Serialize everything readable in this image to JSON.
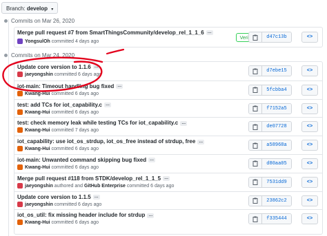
{
  "branch": {
    "label": "Branch:",
    "name": "develop"
  },
  "groups": [
    {
      "header": "Commits on Mar 26, 2020",
      "commits": [
        {
          "title": "Merge pull request #7 from SmartThingsCommunity/develop_rel_1_1_6",
          "author": "YongsulOh",
          "action": "committed",
          "coauthor": "",
          "time": "4 days ago",
          "sha": "d47c13b",
          "verified": "Verified",
          "avatar_color": "#6f42c1"
        }
      ]
    },
    {
      "header": "Commits on Mar 24, 2020",
      "commits": [
        {
          "title": "Update core version to 1.1.6",
          "author": "jaeyongshin",
          "action": "committed",
          "coauthor": "",
          "time": "6 days ago",
          "sha": "d7ebe15",
          "avatar_color": "#d73a49"
        },
        {
          "title": "iot-main: Timeout handling bug fixed",
          "author": "Kwang-Hui",
          "action": "committed",
          "coauthor": "",
          "time": "6 days ago",
          "sha": "5fcbba4",
          "avatar_color": "#e36209"
        },
        {
          "title": "test: add TCs for iot_capability.c",
          "author": "Kwang-Hui",
          "action": "committed",
          "coauthor": "",
          "time": "6 days ago",
          "sha": "f7152a5",
          "avatar_color": "#e36209"
        },
        {
          "title": "test: check memory leak while testing TCs for iot_capability.c",
          "author": "Kwang-Hui",
          "action": "committed",
          "coauthor": "",
          "time": "7 days ago",
          "sha": "de07728",
          "avatar_color": "#e36209"
        },
        {
          "title": "iot_capability: use iot_os_strdup, iot_os_free instead of strdup, free",
          "author": "Kwang-Hui",
          "action": "committed",
          "coauthor": "",
          "time": "6 days ago",
          "sha": "a58968a",
          "avatar_color": "#e36209"
        },
        {
          "title": "iot-main: Unwanted command skipping bug fixed",
          "author": "Kwang-Hui",
          "action": "committed",
          "coauthor": "",
          "time": "6 days ago",
          "sha": "d80aa05",
          "avatar_color": "#e36209"
        },
        {
          "title": "Merge pull request #118 from STDK/develop_rel_1_1_5",
          "author": "jaeyongshin",
          "action": "authored and",
          "coauthor": "GitHub Enterprise",
          "time": "6 days ago",
          "sha": "7531dd9",
          "avatar_color": "#d73a49"
        },
        {
          "title": "Update core version to 1.1.5",
          "author": "jaeyongshin",
          "action": "committed",
          "coauthor": "",
          "time": "6 days ago",
          "sha": "23862c2",
          "avatar_color": "#d73a49"
        },
        {
          "title": "iot_os_util: fix missing header include for strdup",
          "author": "Kwang-Hui",
          "action": "committed",
          "coauthor": "",
          "time": "6 days ago",
          "sha": "f335444",
          "avatar_color": "#e36209"
        }
      ]
    }
  ],
  "browse_label": "<>",
  "colors": {
    "annotation": "#e3001b",
    "verified": "#28a745",
    "link": "#0366d6"
  }
}
